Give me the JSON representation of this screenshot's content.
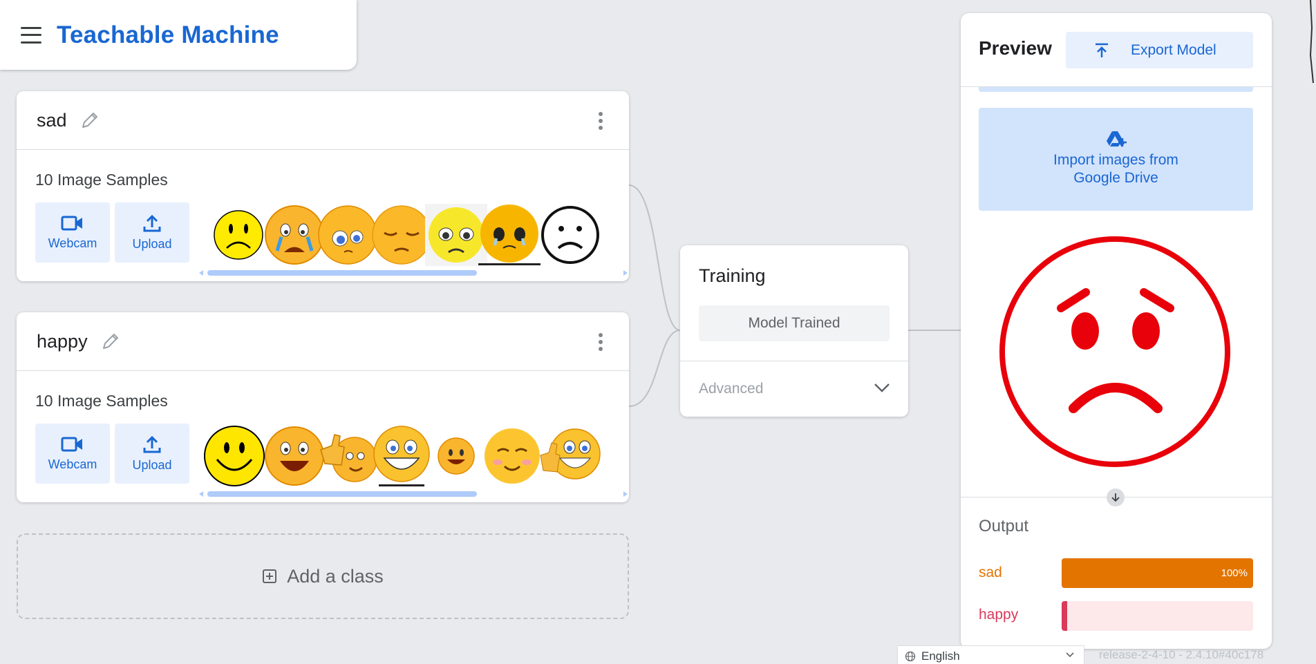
{
  "header": {
    "app_title": "Teachable Machine",
    "menu_icon": "hamburger-menu-icon"
  },
  "classes": [
    {
      "name": "sad",
      "samples_label": "10 Image Samples",
      "webcam_label": "Webcam",
      "upload_label": "Upload",
      "thumbnails": [
        "frowning-face",
        "crying-face",
        "pleading-face",
        "pensive-face",
        "worried-face",
        "teary-face",
        "outline-frown-face"
      ]
    },
    {
      "name": "happy",
      "samples_label": "10 Image Samples",
      "webcam_label": "Webcam",
      "upload_label": "Upload",
      "thumbnails": [
        "smiley-face",
        "laughing-face",
        "thumbs-up-face",
        "grinning-face",
        "small-smile-face",
        "blushing-face",
        "thumbs-up-grin-face"
      ]
    }
  ],
  "add_class": {
    "label": "Add a class",
    "icon": "plus-box-icon"
  },
  "training": {
    "title": "Training",
    "status_button": "Model Trained",
    "advanced_label": "Advanced"
  },
  "preview": {
    "title": "Preview",
    "export_label": "Export Model",
    "drive_line1": "Import images from",
    "drive_line2": "Google Drive",
    "image": "red-sad-face-outline",
    "output_title": "Output",
    "outputs": [
      {
        "label": "sad",
        "value": 1.0,
        "value_label": "100%",
        "color": "#e37400",
        "track": "#fce8e6"
      },
      {
        "label": "happy",
        "value": 0.0,
        "value_label": "",
        "color": "#d93a5a",
        "track": "#fde8ea"
      }
    ]
  },
  "footer": {
    "language": "English",
    "version": "release-2-4-10 - 2.4.10#40c178"
  },
  "colors": {
    "accent": "#1967d2",
    "light_blue": "#e8f0fe",
    "sad_orange": "#e37400",
    "happy_pink": "#d93a5a",
    "preview_red": "#e8000a"
  }
}
